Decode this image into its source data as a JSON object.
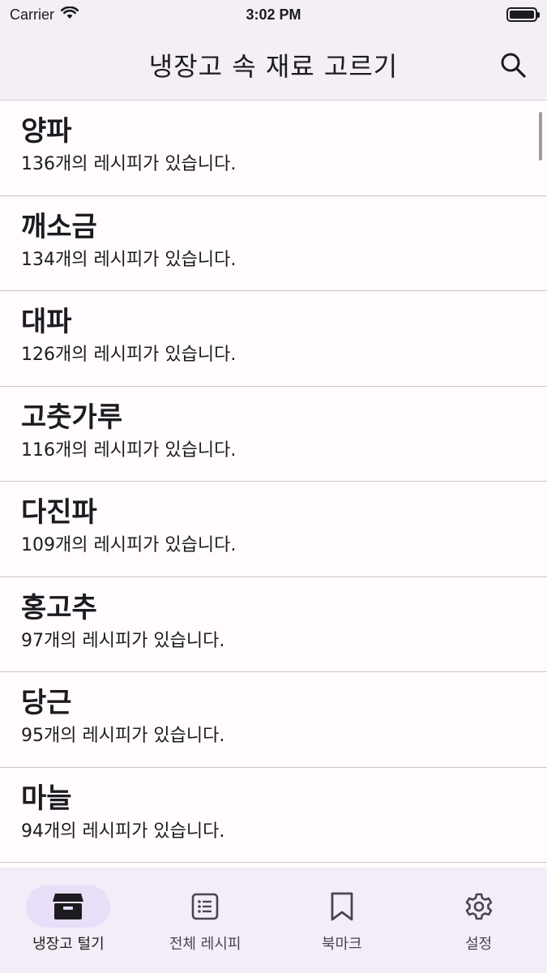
{
  "status_bar": {
    "carrier": "Carrier",
    "time": "3:02 PM"
  },
  "app_bar": {
    "title": "냉장고 속 재료 고르기",
    "search_icon": "search-icon"
  },
  "ingredients": [
    {
      "name": "양파",
      "subtitle": "136개의 레시피가 있습니다."
    },
    {
      "name": "깨소금",
      "subtitle": "134개의 레시피가 있습니다."
    },
    {
      "name": "대파",
      "subtitle": "126개의 레시피가 있습니다."
    },
    {
      "name": "고춧가루",
      "subtitle": "116개의 레시피가 있습니다."
    },
    {
      "name": "다진파",
      "subtitle": "109개의 레시피가 있습니다."
    },
    {
      "name": "홍고추",
      "subtitle": "97개의 레시피가 있습니다."
    },
    {
      "name": "당근",
      "subtitle": "95개의 레시피가 있습니다."
    },
    {
      "name": "마늘",
      "subtitle": "94개의 레시피가 있습니다."
    }
  ],
  "bottom_nav": {
    "items": [
      {
        "label": "냉장고 털기",
        "icon": "inventory-box-icon",
        "active": true
      },
      {
        "label": "전체 레시피",
        "icon": "list-icon",
        "active": false
      },
      {
        "label": "북마크",
        "icon": "bookmark-icon",
        "active": false
      },
      {
        "label": "설정",
        "icon": "gear-icon",
        "active": false
      }
    ]
  },
  "colors": {
    "background": "#fffbfe",
    "bar": "#f3eff4",
    "nav_background": "#f3edf7",
    "active_indicator": "#e8def8",
    "divider": "#c9c5ca",
    "text": "#1c1b1f"
  }
}
